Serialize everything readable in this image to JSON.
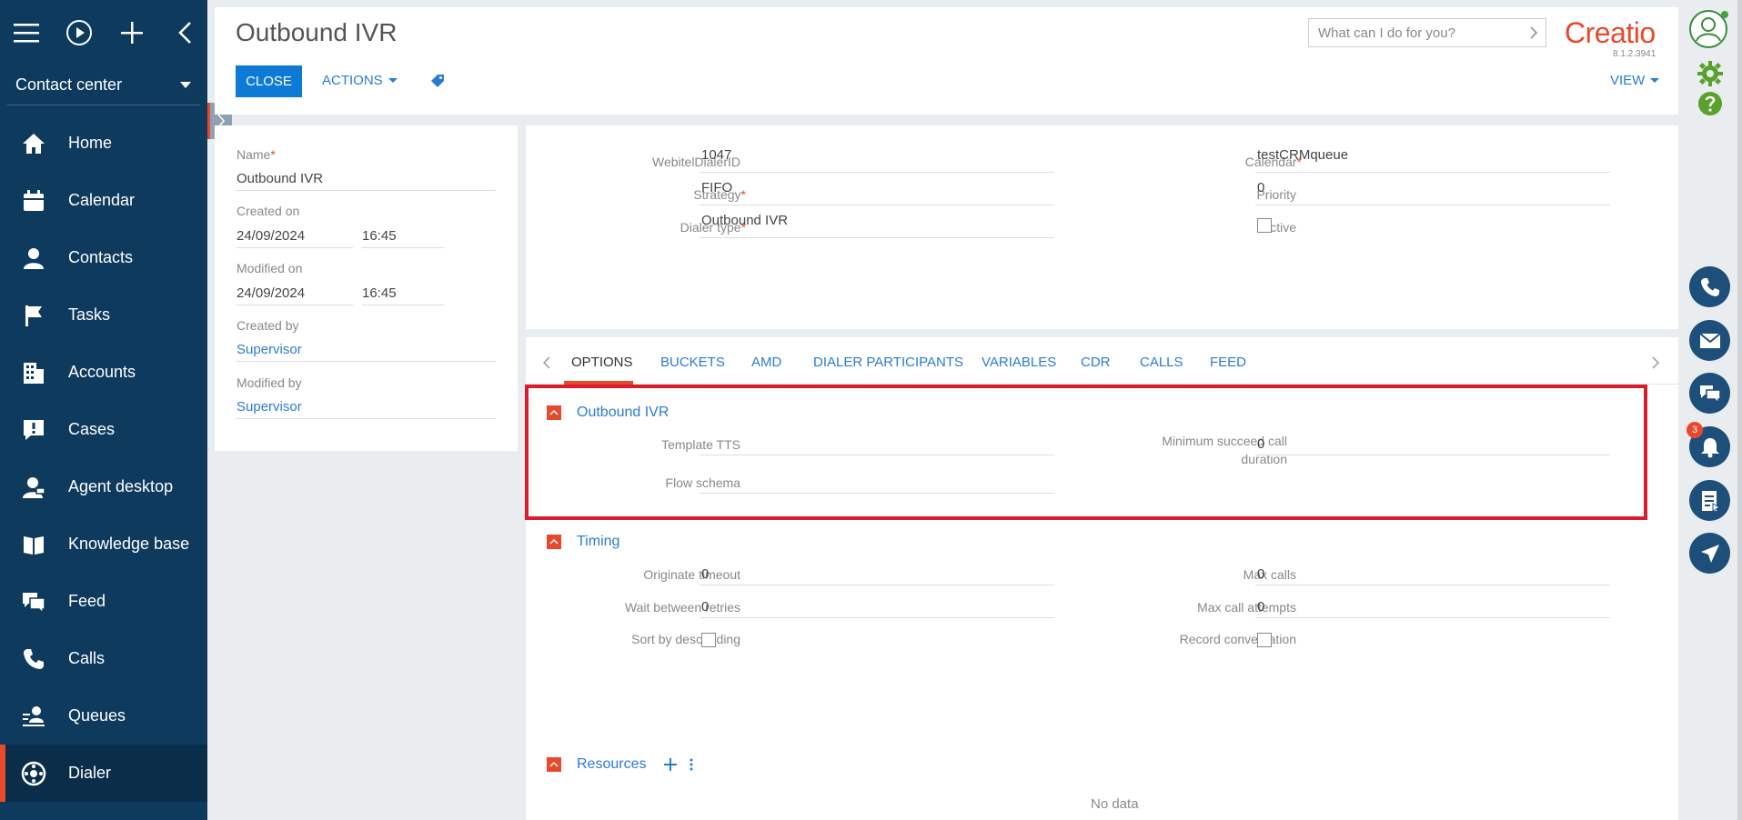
{
  "sidebar": {
    "section": "Contact center",
    "items": [
      {
        "label": "Home",
        "icon": "home-icon"
      },
      {
        "label": "Calendar",
        "icon": "calendar-icon"
      },
      {
        "label": "Contacts",
        "icon": "contact-icon"
      },
      {
        "label": "Tasks",
        "icon": "flag-icon"
      },
      {
        "label": "Accounts",
        "icon": "building-icon"
      },
      {
        "label": "Cases",
        "icon": "case-icon"
      },
      {
        "label": "Agent desktop",
        "icon": "agent-icon"
      },
      {
        "label": "Knowledge base",
        "icon": "book-icon"
      },
      {
        "label": "Feed",
        "icon": "feed-icon"
      },
      {
        "label": "Calls",
        "icon": "phone-icon"
      },
      {
        "label": "Queues",
        "icon": "queue-icon"
      },
      {
        "label": "Dialer",
        "icon": "dialer-icon",
        "active": true
      }
    ]
  },
  "header": {
    "title": "Outbound IVR",
    "close_label": "CLOSE",
    "actions_label": "ACTIONS",
    "search_placeholder": "What can I do for you?",
    "logo": "Creatio",
    "version": "8.1.2.3941",
    "view_label": "VIEW"
  },
  "info": {
    "name_label": "Name",
    "name_value": "Outbound IVR",
    "created_on_label": "Created on",
    "created_date": "24/09/2024",
    "created_time": "16:45",
    "modified_on_label": "Modified on",
    "modified_date": "24/09/2024",
    "modified_time": "16:45",
    "created_by_label": "Created by",
    "created_by_value": "Supervisor",
    "modified_by_label": "Modified by",
    "modified_by_value": "Supervisor"
  },
  "main": {
    "webitel_label": "WebitelDialerID",
    "webitel_value": "1047",
    "strategy_label": "Strategy",
    "strategy_value": "FIFO",
    "dialer_type_label": "Dialer type",
    "dialer_type_value": "Outbound IVR",
    "calendar_label": "Calendar",
    "calendar_value": "testCRMqueue",
    "priority_label": "Priority",
    "priority_value": "0",
    "active_label": "Active"
  },
  "tabs": [
    "OPTIONS",
    "BUCKETS",
    "AMD",
    "DIALER PARTICIPANTS",
    "VARIABLES",
    "CDR",
    "CALLS",
    "FEED"
  ],
  "outbound_group": {
    "title": "Outbound IVR",
    "template_tts_label": "Template TTS",
    "flow_schema_label": "Flow schema",
    "min_succeed_label_1": "Minimum succeed call",
    "min_succeed_label_2": "duration",
    "min_succeed_value": "0"
  },
  "timing_group": {
    "title": "Timing",
    "originate_label": "Originate timeout",
    "originate_value": "0",
    "wait_label": "Wait between retries",
    "wait_value": "0",
    "sort_label": "Sort by descending",
    "max_calls_label": "Max calls",
    "max_calls_value": "0",
    "max_attempts_label": "Max call attempts",
    "max_attempts_value": "0",
    "record_label": "Record conversation"
  },
  "resources_group": {
    "title": "Resources",
    "empty_text": "No data"
  },
  "rail": {
    "notification_count": "3"
  },
  "colors": {
    "sidebar": "#0e3a5e",
    "accent": "#e8492c",
    "link": "#2b7bd6",
    "primary_button": "#0d7bd6",
    "highlight": "#d81e2c"
  }
}
